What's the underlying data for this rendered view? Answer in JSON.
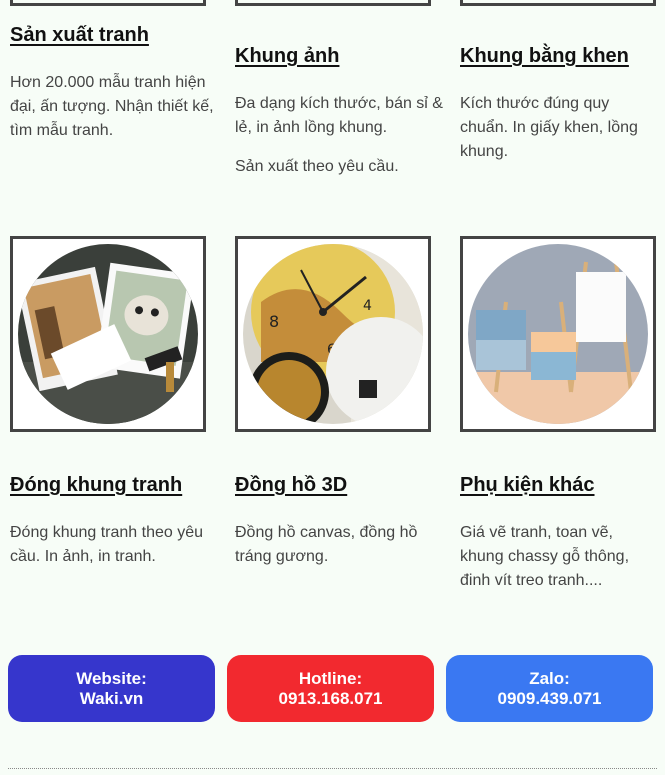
{
  "categories": [
    {
      "title": "Sản xuất tranh",
      "desc": [
        "Hơn 20.000 mẫu tranh hiện đại, ấn tượng. Nhận thiết kế, tìm mẫu tranh."
      ]
    },
    {
      "title": "Khung ảnh",
      "desc": [
        "Đa dạng kích thước, bán sỉ & lẻ, in ảnh lồng khung.",
        "Sản xuất  theo yêu cầu."
      ]
    },
    {
      "title": "Khung bằng khen",
      "desc": [
        "Kích thước đúng quy chuẩn. In giấy khen, lồng khung."
      ]
    },
    {
      "title": "Đóng khung tranh",
      "desc": [
        "Đóng khung tranh theo yêu cầu. In ảnh, in tranh."
      ]
    },
    {
      "title": "Đồng hồ 3D",
      "desc": [
        "Đồng hồ canvas, đồng hồ tráng gương."
      ]
    },
    {
      "title": "Phụ kiện khác",
      "desc": [
        "Giá vẽ tranh, toan vẽ, khung chassy gỗ thông, đinh vít treo tranh...."
      ]
    }
  ],
  "images": [
    {
      "icon": "photo-framing-icon"
    },
    {
      "icon": "clock-3d-icon"
    },
    {
      "icon": "easel-canvas-icon"
    }
  ],
  "contact": {
    "website": {
      "label": "Website:",
      "value": "Waki.vn",
      "color": "#3636cc"
    },
    "hotline": {
      "label": "Hotline:",
      "value": "0913.168.071",
      "color": "#f2292f"
    },
    "zalo": {
      "label": "Zalo:",
      "value": "0909.439.071",
      "color": "#3a78f2"
    }
  }
}
